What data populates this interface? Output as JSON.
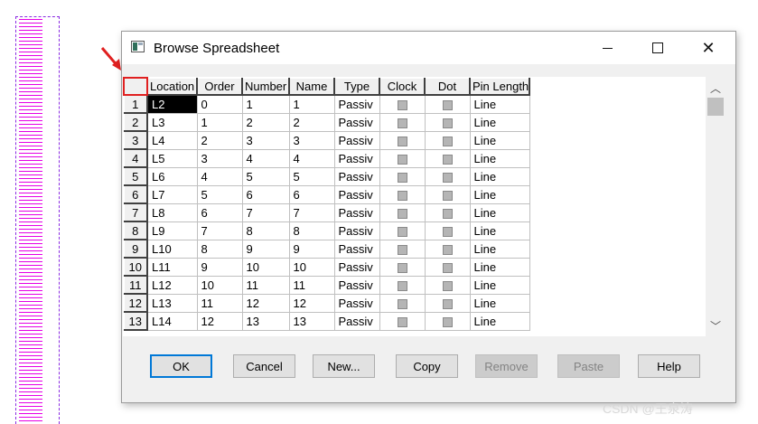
{
  "window": {
    "title": "Browse Spreadsheet"
  },
  "titlebar": {
    "minimize": "—",
    "maximize": "☐",
    "close": "✕"
  },
  "grid": {
    "columns": [
      "Location",
      "Order",
      "Number",
      "Name",
      "Type",
      "Clock",
      "Dot",
      "Pin Length"
    ],
    "rows": [
      {
        "index": "1",
        "location": "L2",
        "order": "0",
        "number": "1",
        "name": "1",
        "type": "Passiv",
        "length": "Line"
      },
      {
        "index": "2",
        "location": "L3",
        "order": "1",
        "number": "2",
        "name": "2",
        "type": "Passiv",
        "length": "Line"
      },
      {
        "index": "3",
        "location": "L4",
        "order": "2",
        "number": "3",
        "name": "3",
        "type": "Passiv",
        "length": "Line"
      },
      {
        "index": "4",
        "location": "L5",
        "order": "3",
        "number": "4",
        "name": "4",
        "type": "Passiv",
        "length": "Line"
      },
      {
        "index": "5",
        "location": "L6",
        "order": "4",
        "number": "5",
        "name": "5",
        "type": "Passiv",
        "length": "Line"
      },
      {
        "index": "6",
        "location": "L7",
        "order": "5",
        "number": "6",
        "name": "6",
        "type": "Passiv",
        "length": "Line"
      },
      {
        "index": "7",
        "location": "L8",
        "order": "6",
        "number": "7",
        "name": "7",
        "type": "Passiv",
        "length": "Line"
      },
      {
        "index": "8",
        "location": "L9",
        "order": "7",
        "number": "8",
        "name": "8",
        "type": "Passiv",
        "length": "Line"
      },
      {
        "index": "9",
        "location": "L10",
        "order": "8",
        "number": "9",
        "name": "9",
        "type": "Passiv",
        "length": "Line"
      },
      {
        "index": "10",
        "location": "L11",
        "order": "9",
        "number": "10",
        "name": "10",
        "type": "Passiv",
        "length": "Line"
      },
      {
        "index": "11",
        "location": "L12",
        "order": "10",
        "number": "11",
        "name": "11",
        "type": "Passiv",
        "length": "Line"
      },
      {
        "index": "12",
        "location": "L13",
        "order": "11",
        "number": "12",
        "name": "12",
        "type": "Passiv",
        "length": "Line"
      },
      {
        "index": "13",
        "location": "L14",
        "order": "12",
        "number": "13",
        "name": "13",
        "type": "Passiv",
        "length": "Line"
      }
    ]
  },
  "buttons": {
    "ok": "OK",
    "cancel": "Cancel",
    "new": "New...",
    "copy": "Copy",
    "remove": "Remove",
    "paste": "Paste",
    "help": "Help"
  },
  "watermark": "CSDN @王泉涛",
  "colors": {
    "annotation": "#e02020",
    "selected_cell": "#000000",
    "pins": "#e600e6"
  }
}
